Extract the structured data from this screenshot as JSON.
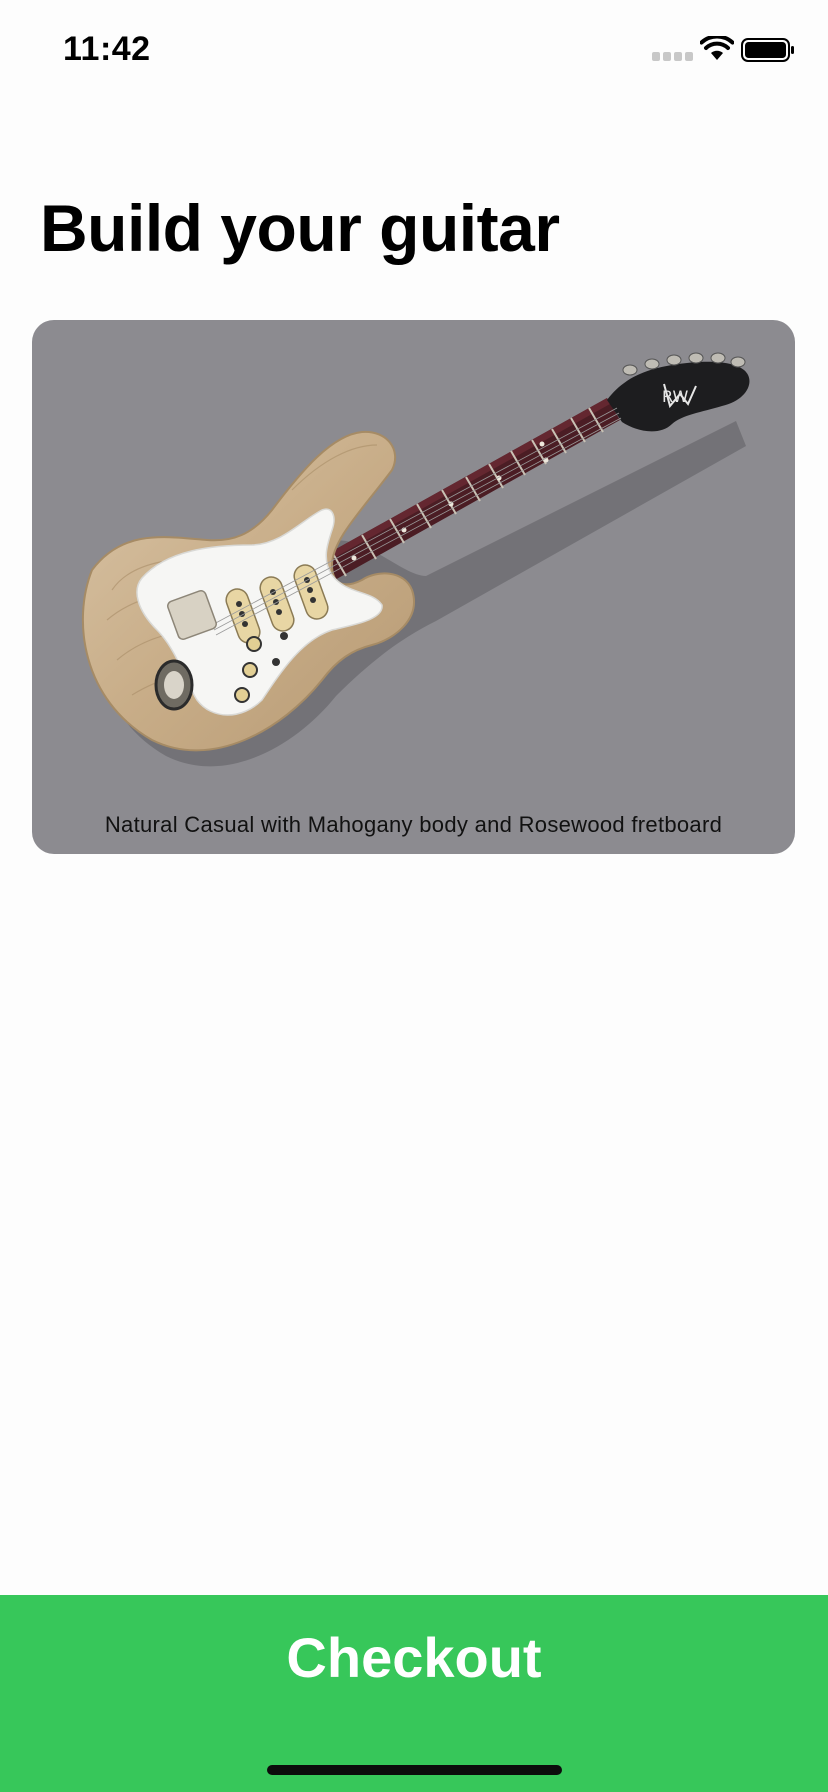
{
  "status_bar": {
    "time": "11:42",
    "signal_icon": "cellular-signal-icon",
    "wifi_icon": "wifi-icon",
    "battery_icon": "battery-icon"
  },
  "page": {
    "title": "Build your guitar"
  },
  "guitar_card": {
    "image_icon": "electric-guitar-illustration",
    "logo_text": "RW",
    "caption": "Natural Casual with Mahogany body and Rosewood fretboard",
    "background_color": "#8c8b90"
  },
  "checkout": {
    "label": "Checkout",
    "color": "#37c75a"
  }
}
